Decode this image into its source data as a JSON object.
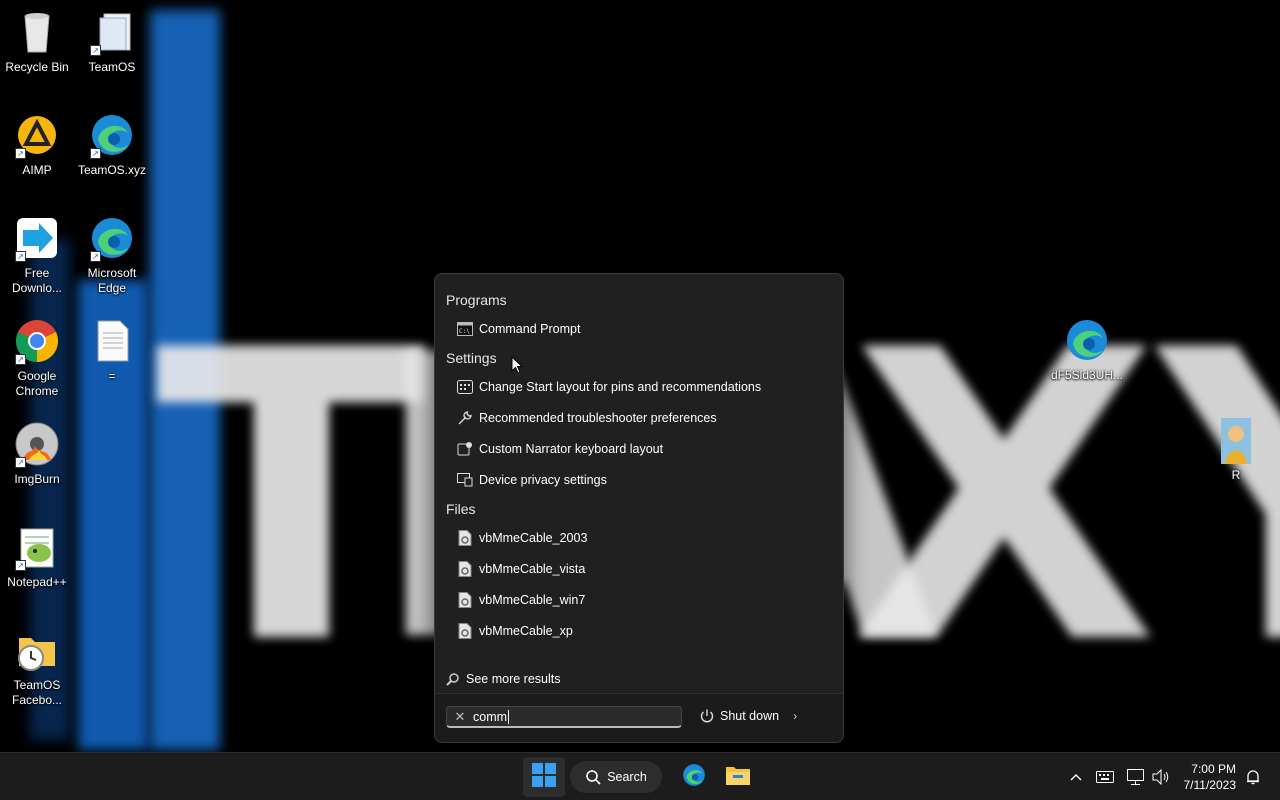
{
  "desktop": {
    "icons": [
      {
        "label": "Recycle Bin",
        "icon": "recycle-bin-icon"
      },
      {
        "label": "TeamOS",
        "icon": "folder-shortcut-icon"
      },
      {
        "label": "AIMP",
        "icon": "aimp-icon"
      },
      {
        "label": "TeamOS.xyz",
        "icon": "edge-icon"
      },
      {
        "label": "Free Downlo...",
        "icon": "free-download-manager-icon"
      },
      {
        "label": "Microsoft Edge",
        "icon": "edge-icon"
      },
      {
        "label": "Google Chrome",
        "icon": "chrome-icon"
      },
      {
        "label": "=",
        "icon": "text-file-icon"
      },
      {
        "label": "ImgBurn",
        "icon": "imgburn-icon"
      },
      {
        "label": "Notepad++",
        "icon": "notepad-plus-plus-icon"
      },
      {
        "label": "TeamOS Facebo...",
        "icon": "folder-clock-icon"
      },
      {
        "label": "dF5Sld3UH...",
        "icon": "edge-icon"
      },
      {
        "label": "R",
        "icon": "image-thumbnail-icon"
      }
    ]
  },
  "search_flyout": {
    "programs": {
      "title": "Programs",
      "items": [
        {
          "label": "Command Prompt",
          "icon": "command-prompt-icon"
        }
      ]
    },
    "settings": {
      "title": "Settings",
      "items": [
        {
          "label": "Change Start layout for pins and recommendations",
          "icon": "layout-icon"
        },
        {
          "label": "Recommended troubleshooter preferences",
          "icon": "wrench-icon"
        },
        {
          "label": "Custom Narrator keyboard layout",
          "icon": "narrator-icon"
        },
        {
          "label": "Device privacy settings",
          "icon": "device-privacy-icon"
        }
      ]
    },
    "files": {
      "title": "Files",
      "items": [
        {
          "label": "vbMmeCable_2003",
          "icon": "config-file-icon"
        },
        {
          "label": "vbMmeCable_vista",
          "icon": "config-file-icon"
        },
        {
          "label": "vbMmeCable_win7",
          "icon": "config-file-icon"
        },
        {
          "label": "vbMmeCable_xp",
          "icon": "config-file-icon"
        }
      ]
    },
    "see_more": "See more results",
    "search_value": "comm",
    "shutdown_label": "Shut down"
  },
  "taskbar": {
    "search_label": "Search",
    "time": "7:00 PM",
    "date": "7/11/2023"
  }
}
